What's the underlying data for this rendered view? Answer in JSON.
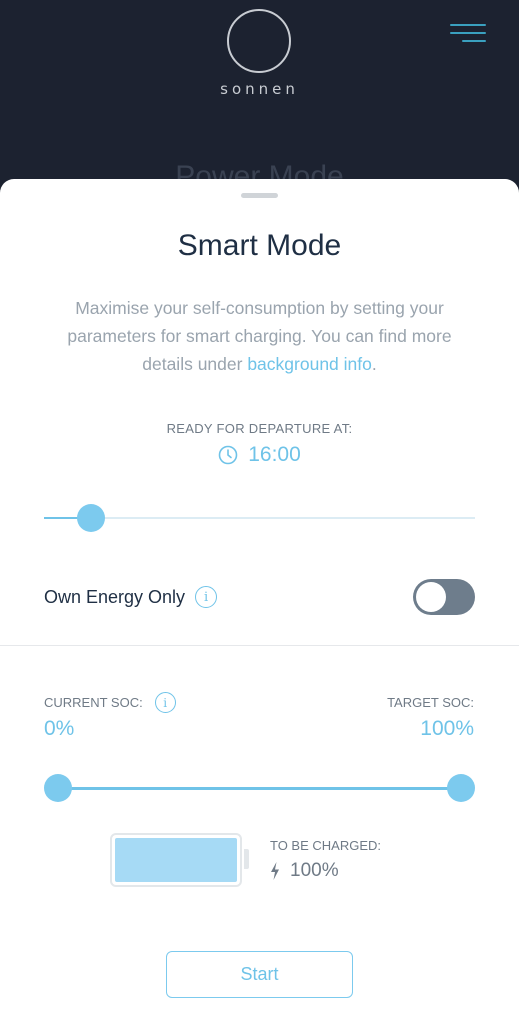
{
  "header": {
    "logo_text": "sonnen",
    "background_title": "Power Mode"
  },
  "sheet": {
    "title": "Smart Mode",
    "description_prefix": "Maximise your self-consumption by setting your parameters for smart charging. You can find more details under ",
    "description_link": "background info",
    "description_suffix": ".",
    "departure": {
      "label": "READY FOR DEPARTURE AT:",
      "time": "16:00",
      "slider_fraction": 0.11
    },
    "own_energy": {
      "label": "Own Energy Only",
      "enabled": false
    },
    "soc": {
      "current_label": "CURRENT SOC:",
      "current_value": "0%",
      "target_label": "TARGET SOC:",
      "target_value": "100%"
    },
    "charge": {
      "label": "TO BE CHARGED:",
      "value": "100%"
    },
    "start_label": "Start"
  },
  "colors": {
    "accent": "#6fc3e8",
    "header_bg": "#1c2230",
    "title": "#1f2f44",
    "toggle_off": "#6e7d8c"
  },
  "icons": [
    "menu-icon",
    "clock-icon",
    "info-icon",
    "bolt-icon",
    "battery-icon"
  ]
}
